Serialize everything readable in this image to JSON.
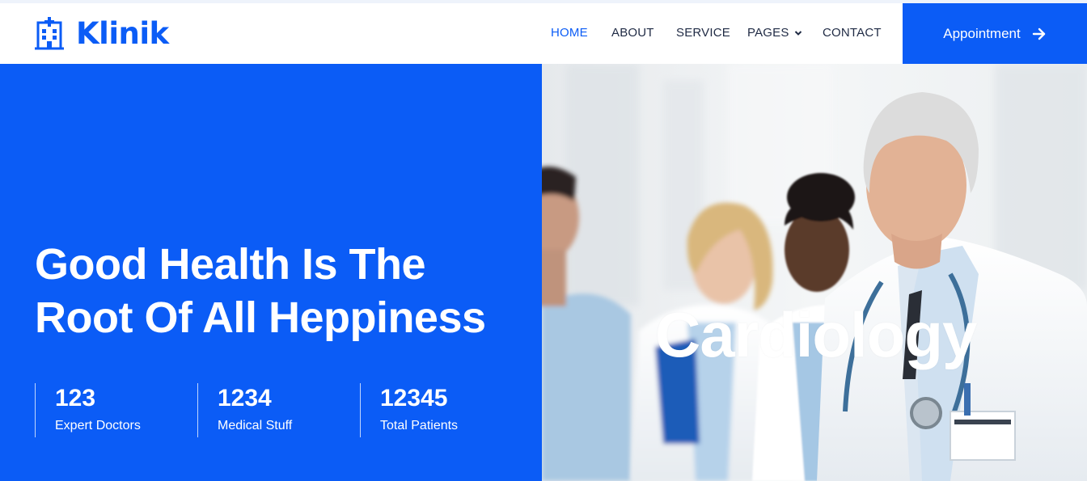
{
  "brand": {
    "name": "Klinik",
    "icon": "hospital-building-icon",
    "color": "#0b5cf6"
  },
  "nav": {
    "items": [
      {
        "label": "HOME",
        "active": true
      },
      {
        "label": "ABOUT",
        "active": false
      },
      {
        "label": "SERVICE",
        "active": false
      },
      {
        "label": "PAGES",
        "active": false,
        "dropdown": true
      },
      {
        "label": "CONTACT",
        "active": false
      }
    ]
  },
  "appointment": {
    "label": "Appointment",
    "icon": "arrow-right-icon"
  },
  "hero": {
    "title_line1": "Good Health Is The",
    "title_line2": "Root Of All Heppiness",
    "slide_caption": "Cardiology",
    "stats": [
      {
        "value": "123",
        "label": "Expert Doctors"
      },
      {
        "value": "1234",
        "label": "Medical Stuff"
      },
      {
        "value": "12345",
        "label": "Total Patients"
      }
    ]
  },
  "colors": {
    "primary": "#0b5cf6",
    "text_dark": "#1f2a44",
    "white": "#ffffff"
  }
}
